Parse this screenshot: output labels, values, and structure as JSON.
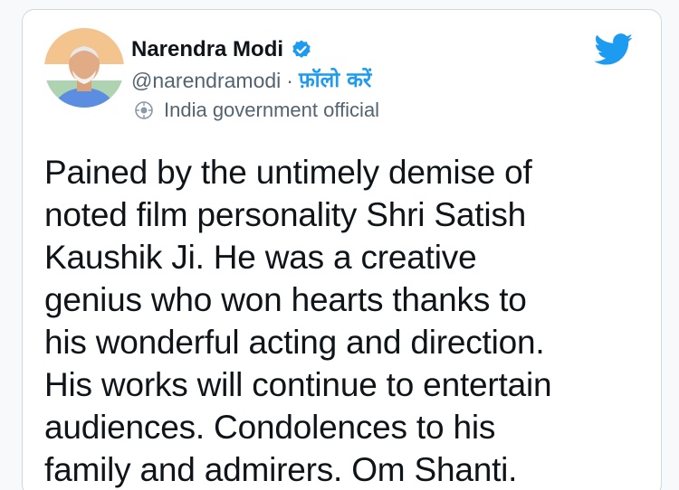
{
  "author": {
    "name": "Narendra Modi",
    "handle": "@narendramodi",
    "separator": "·",
    "follow_label": "फ़ॉलो करें",
    "account_label": "India government official",
    "verified": true
  },
  "icons": {
    "verified": "verified-badge-icon",
    "gov": "government-badge-icon",
    "brand": "twitter-bird-icon"
  },
  "colors": {
    "accent": "#1d9bf0",
    "text_primary": "#0f1419",
    "text_secondary": "#536471"
  },
  "tweet": {
    "lines": [
      "Pained by the untimely demise of",
      "noted film personality Shri Satish",
      "Kaushik Ji. He was a creative",
      "genius who won hearts thanks to",
      "his wonderful acting and direction.",
      "His works will continue to entertain",
      "audiences. Condolences to his",
      "family and admirers. Om Shanti."
    ]
  }
}
